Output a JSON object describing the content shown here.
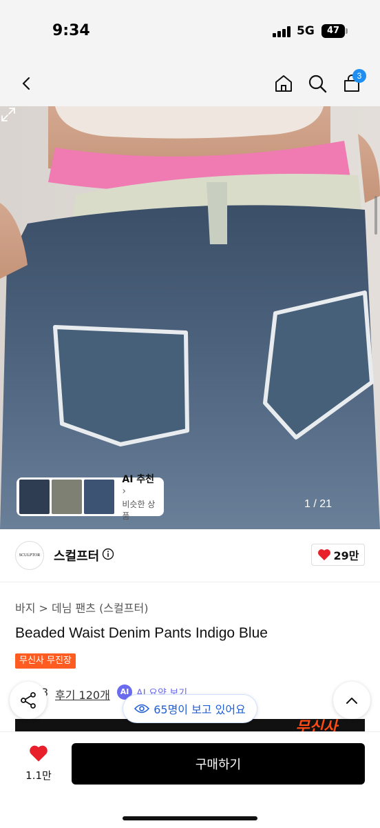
{
  "status_bar": {
    "time": "9:34",
    "network": "5G",
    "battery": "47"
  },
  "nav": {
    "cart_count": "3"
  },
  "image": {
    "ai_title": "AI 추천",
    "ai_subtitle": "비슷한 상품",
    "counter": "1 / 21"
  },
  "brand": {
    "logo_text": "SCULPTOR",
    "name": "스컬프터",
    "likes": "29만"
  },
  "product": {
    "breadcrumb": "바지 > 데님 팬츠 (스컬프터)",
    "title": "Beaded Waist Denim Pants Indigo Blue",
    "badge": "무신사 무진장",
    "rating_partial": "3",
    "reviews": "후기 120개",
    "ai_badge": "AI",
    "ai_summary": "AI 요약 보기"
  },
  "floating": {
    "viewers": "65명이 보고 있어요"
  },
  "promo": {
    "text": "무신사"
  },
  "bottom": {
    "wish_count": "1.1만",
    "buy_label": "구매하기"
  },
  "colors": {
    "accent_blue": "#1f8ef1",
    "badge_orange": "#ff5c21",
    "heart_red": "#e8202b",
    "ai_purple": "#6b6bf0"
  }
}
